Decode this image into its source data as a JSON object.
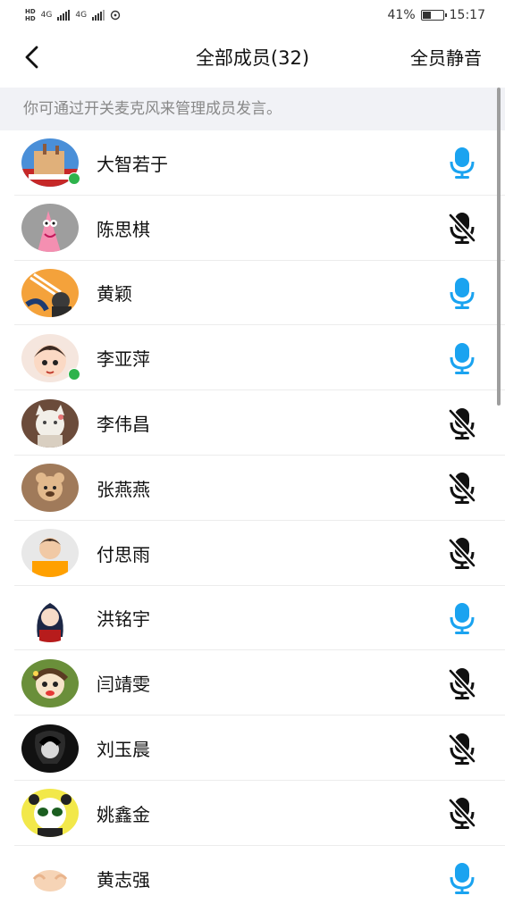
{
  "status": {
    "net1": "4G",
    "net2": "4G",
    "battery_percent": "41%",
    "battery_level": 0.41,
    "time": "15:17"
  },
  "header": {
    "title": "全部成员(32)",
    "mute_all": "全员静音"
  },
  "hint": "你可通过开关麦克风来管理成员发言。",
  "colors": {
    "mic_on": "#1aa3f0",
    "mic_off": "#111111",
    "speaking_dot": "#2eb34c",
    "hint_bg": "#f1f2f6"
  },
  "members": [
    {
      "name": "大智若于",
      "mic": "on",
      "speaking": true
    },
    {
      "name": "陈思棋",
      "mic": "off",
      "speaking": false
    },
    {
      "name": "黄颖",
      "mic": "on",
      "speaking": false
    },
    {
      "name": "李亚萍",
      "mic": "on",
      "speaking": true
    },
    {
      "name": "李伟昌",
      "mic": "off",
      "speaking": false
    },
    {
      "name": "张燕燕",
      "mic": "off",
      "speaking": false
    },
    {
      "name": "付思雨",
      "mic": "off",
      "speaking": false
    },
    {
      "name": "洪铭宇",
      "mic": "on",
      "speaking": false
    },
    {
      "name": "闫靖雯",
      "mic": "off",
      "speaking": false
    },
    {
      "name": "刘玉晨",
      "mic": "off",
      "speaking": false
    },
    {
      "name": "姚鑫金",
      "mic": "off",
      "speaking": false
    },
    {
      "name": "黄志强",
      "mic": "on",
      "speaking": false
    }
  ]
}
